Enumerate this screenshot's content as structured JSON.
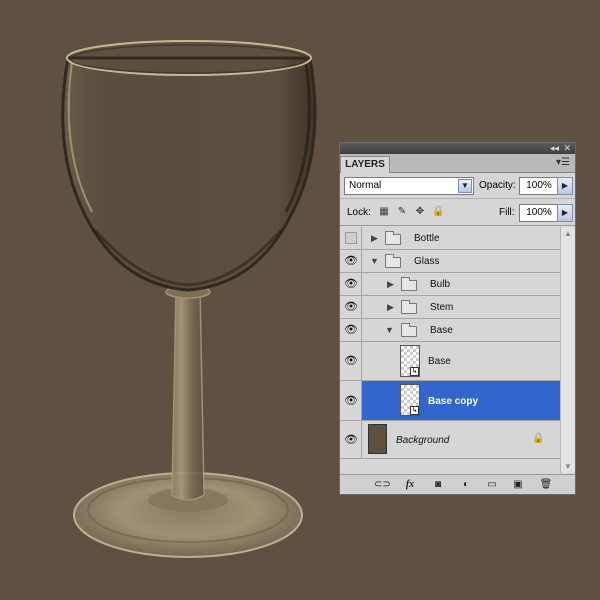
{
  "colors": {
    "canvas_bg": "#5e5141",
    "panel_bg": "#d6d6d6",
    "selected_row": "#3366cc",
    "background_layer_swatch": "#5e5141"
  },
  "panel": {
    "top_controls": {
      "collapse": "◂◂",
      "close": "✕"
    },
    "tab_label": "LAYERS",
    "menu_icon": "panel-menu-icon"
  },
  "blend": {
    "mode": "Normal",
    "opacity_label": "Opacity:",
    "opacity_value": "100%",
    "fill_label": "Fill:",
    "fill_value": "100%"
  },
  "lock": {
    "label": "Lock:",
    "icons": [
      "lock-transparent-icon",
      "lock-image-icon",
      "lock-position-icon",
      "lock-all-icon"
    ]
  },
  "layers": [
    {
      "name": "Bottle",
      "type": "group",
      "visible": false,
      "expanded": false,
      "indent": 0
    },
    {
      "name": "Glass",
      "type": "group",
      "visible": true,
      "expanded": true,
      "indent": 0
    },
    {
      "name": "Bulb",
      "type": "group",
      "visible": true,
      "expanded": false,
      "indent": 1
    },
    {
      "name": "Stem",
      "type": "group",
      "visible": true,
      "expanded": false,
      "indent": 1
    },
    {
      "name": "Base",
      "type": "group",
      "visible": true,
      "expanded": true,
      "indent": 1
    },
    {
      "name": "Base",
      "type": "smart-object",
      "visible": true,
      "selected": false,
      "indent": 2
    },
    {
      "name": "Base copy",
      "type": "smart-object",
      "visible": true,
      "selected": true,
      "indent": 2
    },
    {
      "name": "Background",
      "type": "background",
      "visible": true,
      "locked": true,
      "indent": 0
    }
  ],
  "footer_icons": [
    "link-icon",
    "fx-icon",
    "mask-icon",
    "adjustment-icon",
    "new-group-icon",
    "new-layer-icon",
    "trash-icon"
  ],
  "footer_labels": {
    "fx": "fx"
  }
}
